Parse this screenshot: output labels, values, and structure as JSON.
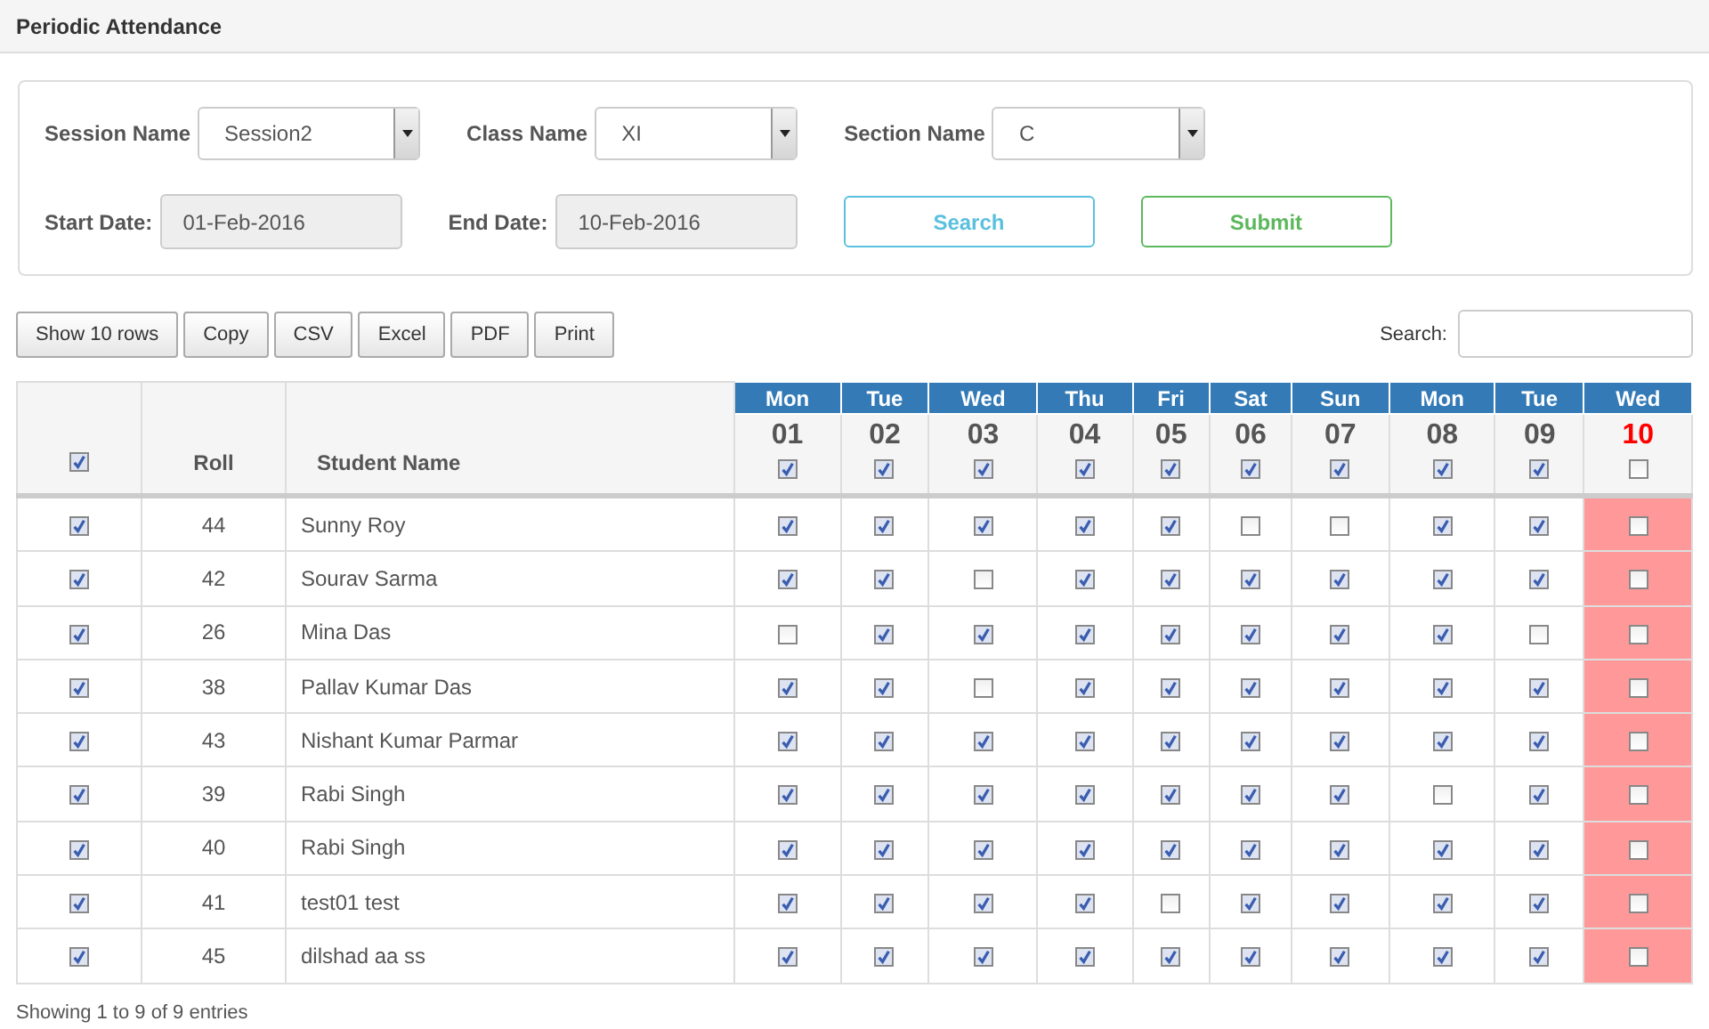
{
  "page_title": "Periodic Attendance",
  "filters": {
    "session": {
      "label": "Session Name",
      "value": "Session2"
    },
    "class": {
      "label": "Class Name",
      "value": "XI"
    },
    "section": {
      "label": "Section Name",
      "value": "C"
    },
    "start_date": {
      "label": "Start Date:",
      "value": "01-Feb-2016"
    },
    "end_date": {
      "label": "End Date:",
      "value": "10-Feb-2016"
    },
    "search_button": "Search",
    "submit_button": "Submit"
  },
  "toolbar": [
    "Show 10 rows",
    "Copy",
    "CSV",
    "Excel",
    "PDF",
    "Print"
  ],
  "search": {
    "label": "Search:"
  },
  "table": {
    "all_checked": true,
    "roll_header": "Roll",
    "name_header": "Student Name",
    "days": [
      {
        "weekday": "Mon",
        "date": "01",
        "checked": true,
        "highlighted": false
      },
      {
        "weekday": "Tue",
        "date": "02",
        "checked": true,
        "highlighted": false
      },
      {
        "weekday": "Wed",
        "date": "03",
        "checked": true,
        "highlighted": false
      },
      {
        "weekday": "Thu",
        "date": "04",
        "checked": true,
        "highlighted": false
      },
      {
        "weekday": "Fri",
        "date": "05",
        "checked": true,
        "highlighted": false
      },
      {
        "weekday": "Sat",
        "date": "06",
        "checked": true,
        "highlighted": false
      },
      {
        "weekday": "Sun",
        "date": "07",
        "checked": true,
        "highlighted": false
      },
      {
        "weekday": "Mon",
        "date": "08",
        "checked": true,
        "highlighted": false
      },
      {
        "weekday": "Tue",
        "date": "09",
        "checked": true,
        "highlighted": false
      },
      {
        "weekday": "Wed",
        "date": "10",
        "checked": false,
        "highlighted": true
      }
    ],
    "rows": [
      {
        "checked": true,
        "roll": "44",
        "name": "Sunny Roy",
        "attendance": [
          true,
          true,
          true,
          true,
          true,
          false,
          false,
          true,
          true,
          false
        ]
      },
      {
        "checked": true,
        "roll": "42",
        "name": "Sourav Sarma",
        "attendance": [
          true,
          true,
          false,
          true,
          true,
          true,
          true,
          true,
          true,
          false
        ]
      },
      {
        "checked": true,
        "roll": "26",
        "name": "Mina Das",
        "attendance": [
          false,
          true,
          true,
          true,
          true,
          true,
          true,
          true,
          false,
          false
        ]
      },
      {
        "checked": true,
        "roll": "38",
        "name": "Pallav Kumar Das",
        "attendance": [
          true,
          true,
          false,
          true,
          true,
          true,
          true,
          true,
          true,
          false
        ]
      },
      {
        "checked": true,
        "roll": "43",
        "name": "Nishant Kumar Parmar",
        "attendance": [
          true,
          true,
          true,
          true,
          true,
          true,
          true,
          true,
          true,
          false
        ]
      },
      {
        "checked": true,
        "roll": "39",
        "name": "Rabi Singh",
        "attendance": [
          true,
          true,
          true,
          true,
          true,
          true,
          true,
          false,
          true,
          false
        ]
      },
      {
        "checked": true,
        "roll": "40",
        "name": "Rabi Singh",
        "attendance": [
          true,
          true,
          true,
          true,
          true,
          true,
          true,
          true,
          true,
          false
        ]
      },
      {
        "checked": true,
        "roll": "41",
        "name": "test01 test",
        "attendance": [
          true,
          true,
          true,
          true,
          false,
          true,
          true,
          true,
          true,
          false
        ]
      },
      {
        "checked": true,
        "roll": "45",
        "name": "dilshad aa ss",
        "attendance": [
          true,
          true,
          true,
          true,
          true,
          true,
          true,
          true,
          true,
          false
        ]
      }
    ]
  },
  "footer": "Showing 1 to 9 of 9 entries"
}
